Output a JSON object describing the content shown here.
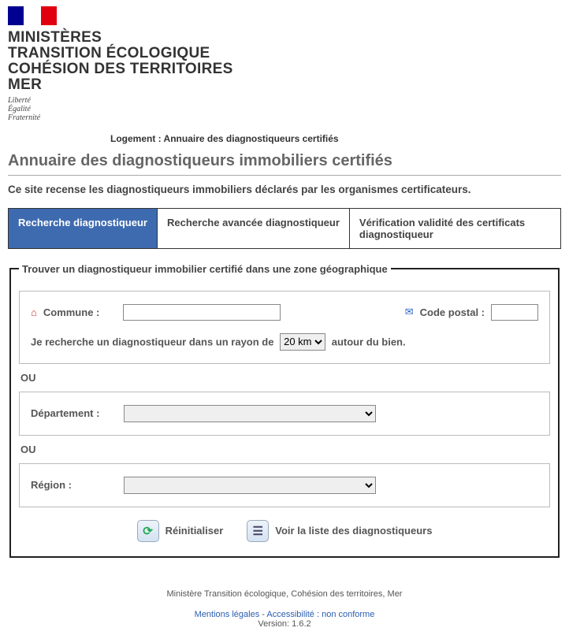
{
  "header": {
    "ministere_lines": [
      "MINISTÈRES",
      "TRANSITION ÉCOLOGIQUE",
      "COHÉSION DES TERRITOIRES",
      "MER"
    ],
    "devise": [
      "Liberté",
      "Égalité",
      "Fraternité"
    ]
  },
  "breadcrumb": "Logement : Annuaire des diagnostiqueurs certifiés",
  "page_title": "Annuaire des diagnostiqueurs immobiliers certifiés",
  "subtitle": "Ce site recense les diagnostiqueurs immobiliers déclarés par les organismes certificateurs.",
  "tabs": [
    {
      "label": "Recherche diagnostiqueur",
      "active": true
    },
    {
      "label": "Recherche avancée diagnostiqueur",
      "active": false
    },
    {
      "label": "Vérification validité des certificats diagnostiqueur",
      "active": false
    }
  ],
  "fieldset_legend": "Trouver un diagnostiqueur immobilier certifié dans une zone géographique",
  "form": {
    "commune_label": "Commune :",
    "commune_value": "",
    "codepostal_label": "Code postal :",
    "codepostal_value": "",
    "radius_pre": "Je recherche un diagnostiqueur dans un rayon de",
    "radius_options": [
      "20 km"
    ],
    "radius_selected": "20 km",
    "radius_post": "autour du bien.",
    "ou": "OU",
    "departement_label": "Département :",
    "departement_value": "",
    "region_label": "Région :",
    "region_value": ""
  },
  "actions": {
    "reset": "Réinitialiser",
    "list": "Voir la liste des diagnostiqueurs"
  },
  "footer": {
    "line1": "Ministère Transition écologique, Cohésion des territoires, Mer",
    "link1": "Mentions légales",
    "sep": " - ",
    "link2": "Accessibilité : non conforme",
    "version": "Version: 1.6.2"
  }
}
